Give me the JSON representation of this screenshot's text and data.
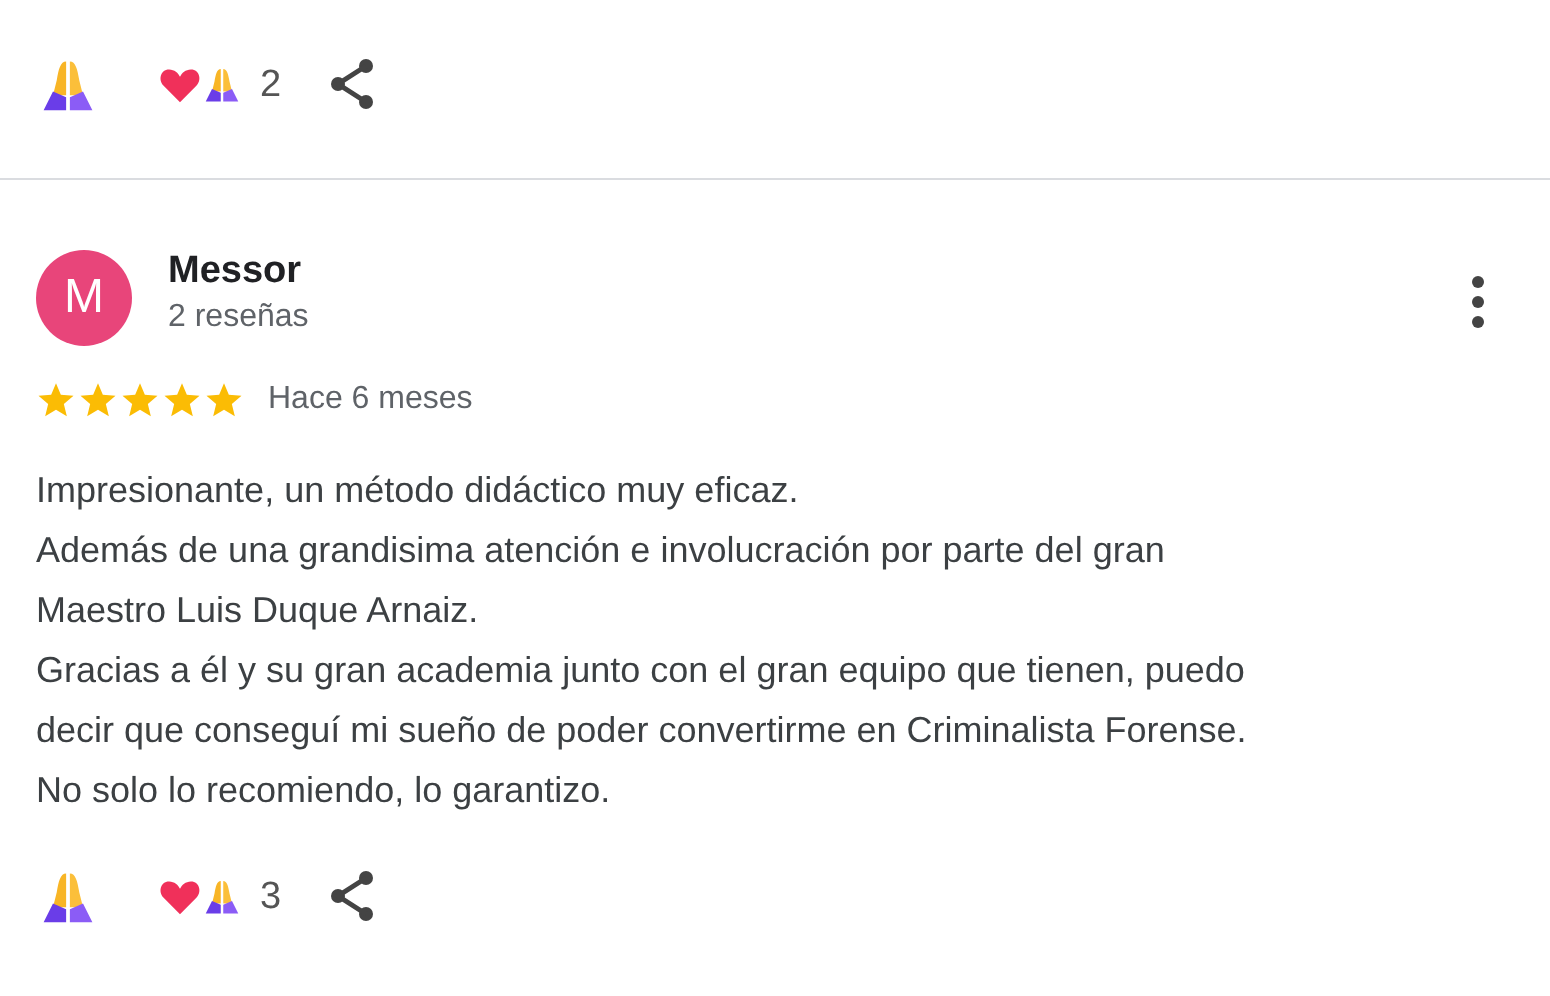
{
  "top_reactions": {
    "count": "2"
  },
  "review": {
    "avatar": {
      "letter": "M",
      "color": "#e8457a"
    },
    "author": "Messor",
    "review_count": "2 reseñas",
    "stars": 5,
    "time": "Hace 6 meses",
    "lines": [
      "Impresionante, un método didáctico muy eficaz.",
      "Además de una grandisima atención e involucración por parte del gran",
      "Maestro Luis Duque Arnaiz.",
      "Gracias a él y su gran academia junto con el gran equipo que tienen, puedo",
      "decir que conseguí mi sueño de poder convertirme en Criminalista Forense.",
      "No solo lo recomiendo, lo garantizo."
    ],
    "reactions": {
      "count": "3"
    }
  }
}
